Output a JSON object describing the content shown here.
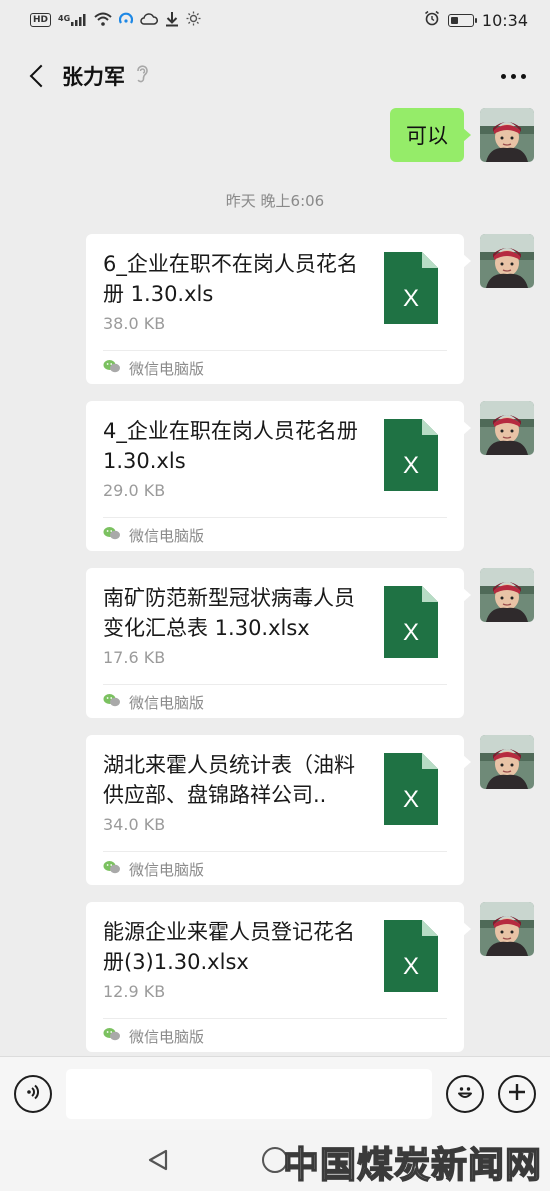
{
  "status_bar": {
    "hd_badge": "HD",
    "network": "4G",
    "time": "10:34",
    "battery_level": 0.35,
    "icons": [
      "hd-icon",
      "signal-icon",
      "wifi-icon",
      "hotspot-icon",
      "cloud-icon",
      "download-icon",
      "brightness-icon",
      "alarm-icon",
      "battery-icon"
    ]
  },
  "header": {
    "contact_name": "张力军",
    "back_icon": "chevron-left-icon",
    "mute_icon": "ear-icon",
    "more_icon": "more-dots-icon"
  },
  "messages": {
    "text_message": "可以",
    "timestamp": "昨天 晚上6:06",
    "files": [
      {
        "name": "6_企业在职不在岗人员花名册 1.30.xls",
        "size": "38.0 KB",
        "source": "微信电脑版",
        "type_letter": "X"
      },
      {
        "name": "4_企业在职在岗人员花名册 1.30.xls",
        "size": "29.0 KB",
        "source": "微信电脑版",
        "type_letter": "X"
      },
      {
        "name": "南矿防范新型冠状病毒人员变化汇总表 1.30.xlsx",
        "size": "17.6 KB",
        "source": "微信电脑版",
        "type_letter": "X"
      },
      {
        "name": "湖北来霍人员统计表（油料供应部、盘锦路祥公司..",
        "size": "34.0 KB",
        "source": "微信电脑版",
        "type_letter": "X"
      },
      {
        "name": "能源企业来霍人员登记花名册(3)1.30.xlsx",
        "size": "12.9 KB",
        "source": "微信电脑版",
        "type_letter": "X"
      }
    ]
  },
  "input_bar": {
    "value": "",
    "voice_icon": "voice-icon",
    "emoji_icon": "emoji-icon",
    "plus_icon": "plus-icon"
  },
  "nav_bar": {
    "back_icon": "triangle-back-icon",
    "home_icon": "circle-home-icon"
  },
  "watermark": "中国煤炭新闻网",
  "colors": {
    "background": "#ededed",
    "sent_bubble": "#95ec69",
    "excel_green": "#1f7244",
    "excel_fold": "#b7dcc5"
  }
}
